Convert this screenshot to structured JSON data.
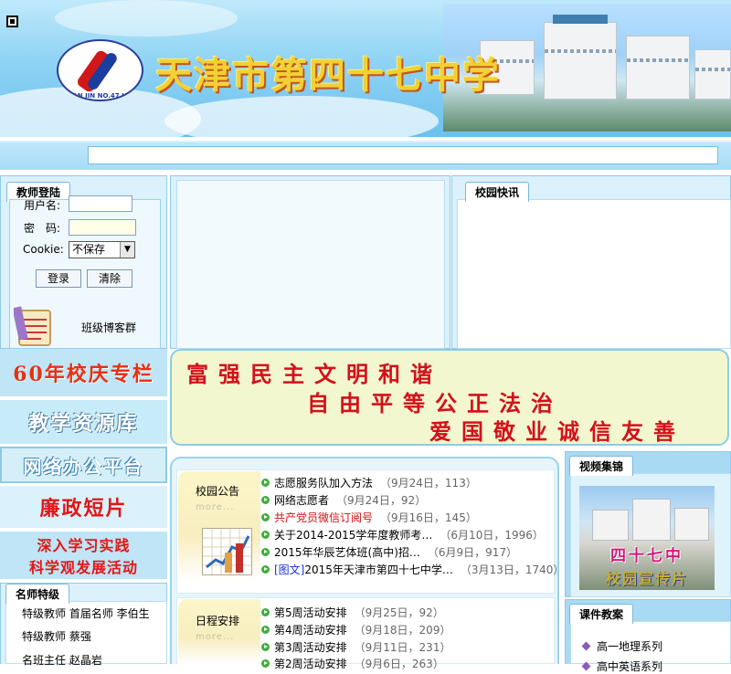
{
  "banner": {
    "school_title": "天津市第四十七中学",
    "logo_text": "TIAN JIN NO.47 HIGH SCHOOL"
  },
  "login": {
    "tab": "教师登陆",
    "username_label": "用户名:",
    "password_label": "密　码:",
    "cookie_label": "Cookie:",
    "cookie_value": "不保存",
    "login_button": "登录",
    "clear_button": "清除",
    "blog_link": "班级博客群"
  },
  "campus_news": {
    "tab": "校园快讯"
  },
  "left_links": [
    {
      "label": "60年校庆专栏"
    },
    {
      "label": "教学资源库"
    },
    {
      "label": "网络办公平台"
    },
    {
      "label": "廉政短片"
    },
    {
      "label_line1": "深入学习实践",
      "label_line2": "科学观发展活动"
    }
  ],
  "slogan": {
    "line1": "富强民主文明和谐",
    "line2": "自由平等公正法治",
    "line3": "爱国敬业诚信友善"
  },
  "notices": {
    "head": "校园公告",
    "more": "more...",
    "items": [
      {
        "title": "志愿服务队加入方法",
        "meta": "（9月24日，113）"
      },
      {
        "title": "网络志愿者",
        "meta": "（9月24日，92）"
      },
      {
        "title": "共产党员微信订阅号",
        "meta": "（9月16日，145）",
        "style": "red"
      },
      {
        "title": "关于2014-2015学年度教师考…",
        "meta": "（6月10日，1996）"
      },
      {
        "title": "2015年华辰艺体班(高中)招…",
        "meta": "（6月9日，917）"
      },
      {
        "prefix": "[图文]",
        "title": "2015年天津市第四十七中学…",
        "meta": "（3月13日，1740）"
      }
    ]
  },
  "schedule": {
    "head": "日程安排",
    "more": "more...",
    "items": [
      {
        "title": "第5周活动安排",
        "meta": "（9月25日，92）"
      },
      {
        "title": "第4周活动安排",
        "meta": "（9月18日，209）"
      },
      {
        "title": "第3周活动安排",
        "meta": "（9月11日，231）"
      },
      {
        "title": "第2周活动安排",
        "meta": "（9月6日，263）"
      }
    ]
  },
  "video": {
    "tab": "视频集锦",
    "caption1": "四十七中",
    "caption2": "校园宣传片"
  },
  "courseware": {
    "tab": "课件教案",
    "items": [
      "高一地理系列",
      "高中英语系列"
    ]
  },
  "famous_teachers": {
    "tab": "名师特级",
    "items": [
      "特级教师 首届名师 李伯生",
      "特级教师 蔡强",
      "名班主任 赵晶岩"
    ]
  },
  "colors": {
    "panel_bg": "#dbf1fc",
    "slogan_text": "#d4101a",
    "accent_blue": "#1a5fb4"
  }
}
